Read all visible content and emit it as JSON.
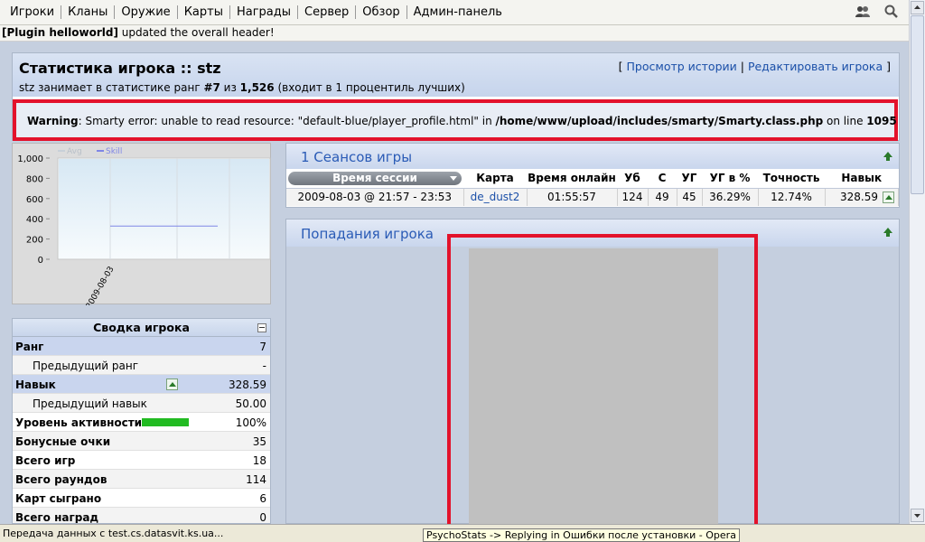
{
  "nav": {
    "items": [
      "Игроки",
      "Кланы",
      "Оружие",
      "Карты",
      "Награды",
      "Сервер",
      "Обзор",
      "Админ-панель"
    ]
  },
  "plugin": {
    "tag": "[Plugin helloworld]",
    "message": " updated the overall header!"
  },
  "player": {
    "title": "Статистика игрока :: stz",
    "sub_name": "stz",
    "sub_text1": " занимает в статистике ранг ",
    "rank": "#7",
    "sub_text2": " из ",
    "total": "1,526",
    "sub_text3": " (входит в 1 процентиль лучших)"
  },
  "links": {
    "open": "[ ",
    "history": "Просмотр истории",
    "sep": " | ",
    "edit": "Редактировать игрока",
    "close": " ]"
  },
  "warning": {
    "label": "Warning",
    "msg": ": Smarty error: unable to read resource: \"default-blue/player_profile.html\" in ",
    "path": "/home/www/upload/includes/smarty/Smarty.class.php",
    "online": " on line ",
    "line": "1095"
  },
  "chart_data": {
    "type": "line",
    "legend": [
      "Avg",
      "Skill"
    ],
    "yticks": [
      "1,000",
      "800",
      "600",
      "400",
      "200",
      "0"
    ],
    "ylim": [
      0,
      1000
    ],
    "x": [
      "2009-08-03"
    ],
    "series": [
      {
        "name": "Skill",
        "values": [
          328.59
        ]
      }
    ]
  },
  "sessions": {
    "title": "1 Сеансов игры",
    "headers": [
      "Время сессии",
      "Карта",
      "Время онлайн",
      "Уб",
      "С",
      "УГ",
      "УГ в %",
      "Точность",
      "Навык"
    ],
    "row": {
      "time": "2009-08-03 @ 21:57 - 23:53",
      "map": "de_dust2",
      "online": "01:55:57",
      "kills": "124",
      "deaths": "49",
      "hs": "45",
      "hs_pct": "36.29%",
      "accuracy": "12.74%",
      "skill": "328.59"
    }
  },
  "hits": {
    "title": "Попадания игрока"
  },
  "summary": {
    "title": "Сводка игрока",
    "rows": [
      {
        "label": "Ранг",
        "value": "7"
      },
      {
        "label": "Предыдущий ранг",
        "value": "-"
      },
      {
        "label": "Навык",
        "value": "328.59"
      },
      {
        "label": "Предыдущий навык",
        "value": "50.00"
      },
      {
        "label": "Уровень активности",
        "value": "100%",
        "activity": 1.0
      },
      {
        "label": "Бонусные очки",
        "value": "35"
      },
      {
        "label": "Всего игр",
        "value": "18"
      },
      {
        "label": "Всего раундов",
        "value": "114"
      },
      {
        "label": "Карт сыграно",
        "value": "6"
      },
      {
        "label": "Всего наград",
        "value": "0"
      }
    ]
  },
  "status": {
    "left": "Передача данных с test.cs.datasvit.ks.ua...",
    "tip": "PsychoStats -> Replying in Ошибки после установки - Opera"
  }
}
